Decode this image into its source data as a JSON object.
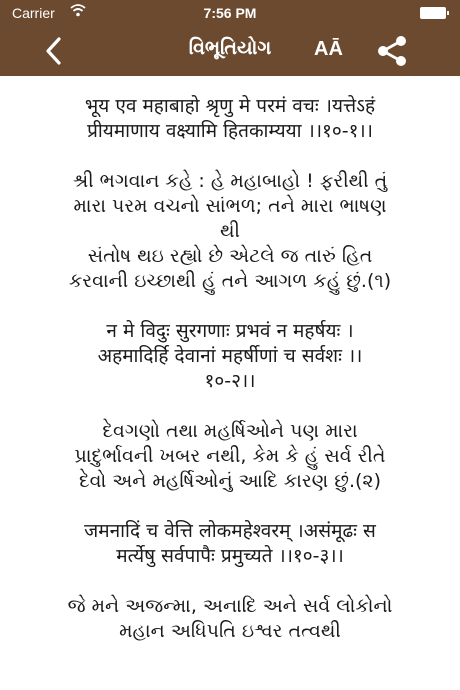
{
  "status_bar": {
    "carrier": "Carrier",
    "time": "7:56 PM"
  },
  "nav": {
    "title": "વિભૂતિયોગ",
    "font_button_label": "AĀ",
    "back_icon": "chevron-left-icon",
    "share_icon": "share-icon"
  },
  "colors": {
    "header": "#6b4a2f",
    "text": "#1a1a1a",
    "background": "#ffffff"
  },
  "verses": [
    {
      "lines": [
        "भूय एव महाबाहो श्रृणु मे परमं वचः ।यत्तेऽहं",
        "प्रीयमाणाय वक्ष्यामि हितकाम्यया ।।१०-१।।"
      ]
    },
    {
      "lines": [
        "શ્રી ભગવાન કહે : હે મહાબાહો ! ફરીથી તું",
        "મારા પરમ વચનો સાંભળ; તને મારા ભાષણ",
        "થી",
        "સંતોષ થઇ રહ્યો છે એટલે જ તારું હિત",
        "કરવાની ઇચ્છાથી હું તને આગળ કહું છું.(૧)"
      ]
    },
    {
      "lines": [
        "न मे विदुः सुरगणाः प्रभवं न महर्षयः ।",
        "अहमादिर्हि देवानां महर्षीणां च सर्वशः ।।",
        "१०-२।।"
      ]
    },
    {
      "lines": [
        "દેવગણો તથા મહર્ષિઓને પણ મારા",
        "પ્રાદુર્ભાવની ખબર નથી, કેમ કે હું સર્વ રીતે",
        "દેવો અને મહર્ષિઓનું આદિ કારણ છું.(૨)"
      ]
    },
    {
      "lines": [
        "जमनादिं च वेत्ति लोकमहेश्वरम् ।असंमूढः स",
        "मर्त्येषु सर्वपापैः प्रमुच्यते ।।१०-३।।"
      ]
    },
    {
      "lines": [
        "જે મને અજન્મા, અનાદિ અને સર્વ લોકોનો",
        "મહાન અધિપતિ ઇશ્વર તત્વથી"
      ]
    }
  ]
}
